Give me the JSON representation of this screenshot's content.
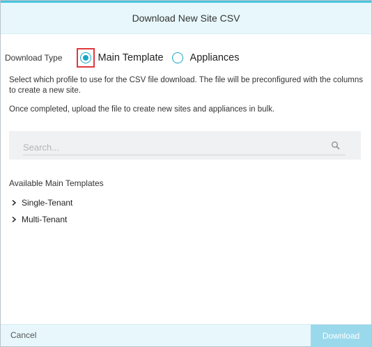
{
  "dialog": {
    "title": "Download New Site CSV"
  },
  "download_type": {
    "label": "Download Type",
    "options": [
      {
        "label": "Main Template",
        "selected": true
      },
      {
        "label": "Appliances",
        "selected": false
      }
    ]
  },
  "description": {
    "line1": "Select which profile to use for the CSV file download. The file will be preconfigured with the columns to create a new site.",
    "line2": "Once completed, upload the file to create new sites and appliances in bulk."
  },
  "search": {
    "placeholder": "Search...",
    "value": ""
  },
  "templates": {
    "title": "Available Main Templates",
    "items": [
      {
        "label": "Single-Tenant"
      },
      {
        "label": "Multi-Tenant"
      }
    ]
  },
  "footer": {
    "cancel_label": "Cancel",
    "download_label": "Download"
  },
  "colors": {
    "accent": "#1aa5c7",
    "header_bg": "#e7f7fb",
    "highlight": "#e0383d",
    "download_disabled": "#9ad9eb"
  }
}
